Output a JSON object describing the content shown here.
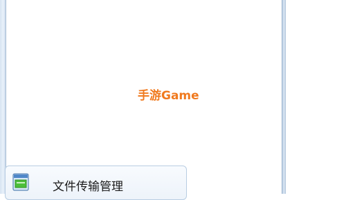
{
  "watermark": {
    "text": "手游Game",
    "color": "#f07a1f"
  },
  "menu": {
    "items": [
      {
        "label": "文件传输管理",
        "icon": "file-transfer-window-icon"
      }
    ]
  }
}
